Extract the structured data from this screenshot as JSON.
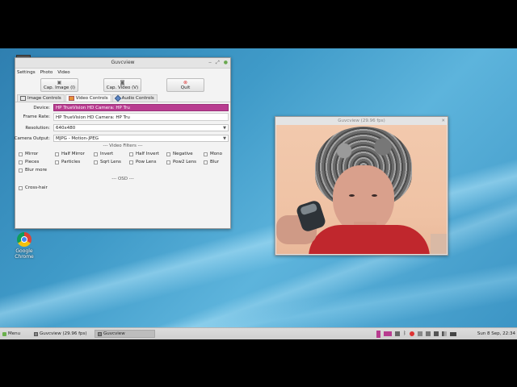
{
  "desktop": {
    "icons": [
      {
        "label": "Google Chrome",
        "icon": "chrome-icon"
      }
    ]
  },
  "main_window": {
    "title": "Guvcview",
    "menu": [
      "Settings",
      "Photo",
      "Video"
    ],
    "toolbar": {
      "cap_image": "Cap. Image (I)",
      "cap_video": "Cap. Video (V)",
      "quit": "Quit"
    },
    "tabs": [
      "Image Controls",
      "Video Controls",
      "Audio Controls"
    ],
    "active_tab": "Video Controls",
    "form": {
      "device_label": "Device:",
      "device_value": "HP TrueVision HD Camera: HP Tru",
      "frame_rate_label": "Frame Rate:",
      "dropdown_item": "HP TrueVision HD Camera: HP Tru",
      "resolution_label": "Resolution:",
      "resolution_value": "640x480",
      "camera_output_label": "Camera Output:",
      "camera_output_value": "MJPG - Motion-JPEG"
    },
    "video_filters_title": "--- Video Filters ---",
    "filters": [
      "Mirror",
      "Half Mirror",
      "Invert",
      "Half Invert",
      "Negative",
      "Mono",
      "Pieces",
      "Particles",
      "Sqrt Lens",
      "Pow Lens",
      "Pow2 Lens",
      "Blur",
      "Blur more"
    ],
    "crosshair": "Cross-hair",
    "osd_title": "--- OSD ---"
  },
  "video_window": {
    "title": "Guvcview (29.96 fps)"
  },
  "taskbar": {
    "menu": "Menu",
    "windows": [
      "Guvcview (29.96 fps)",
      "Guvcview"
    ],
    "clock": "Sun 8 Sep, 22:34"
  }
}
